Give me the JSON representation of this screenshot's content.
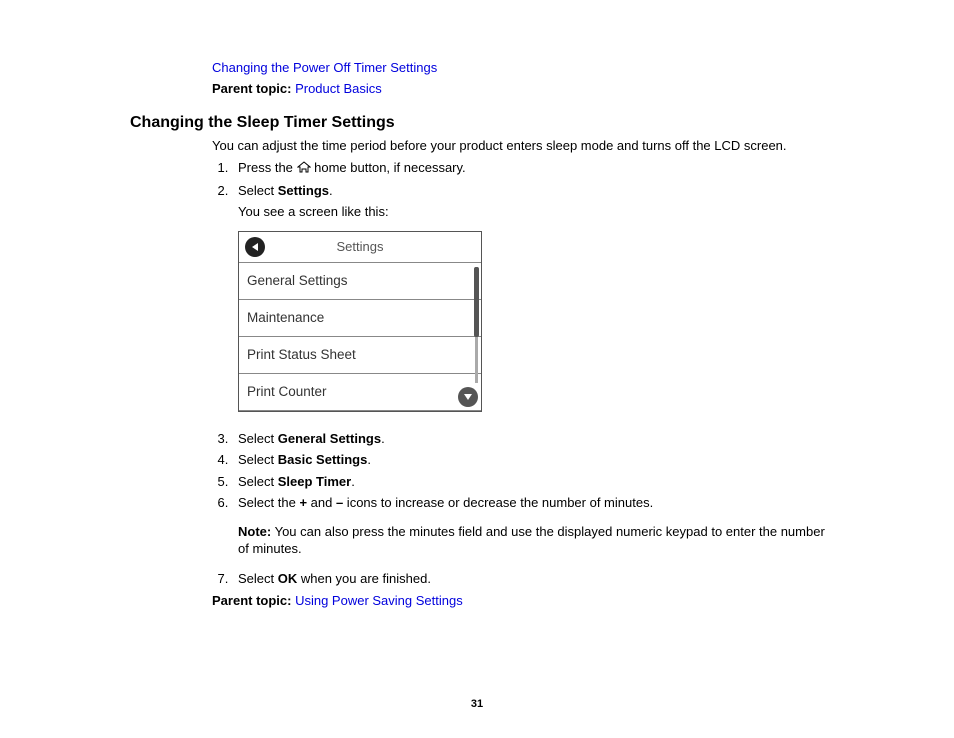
{
  "top_link": "Changing the Power Off Timer Settings",
  "parent_topic_label_1": "Parent topic: ",
  "parent_topic_link_1": "Product Basics",
  "heading": "Changing the Sleep Timer Settings",
  "intro": "You can adjust the time period before your product enters sleep mode and turns off the LCD screen.",
  "step1_a": "Press the ",
  "step1_b": " home button, if necessary.",
  "step2_a": "Select ",
  "step2_bold": "Settings",
  "step2_b": ".",
  "step2_sub": "You see a screen like this:",
  "screen": {
    "title": "Settings",
    "items": [
      "General Settings",
      "Maintenance",
      "Print Status Sheet",
      "Print Counter"
    ]
  },
  "step3_a": "Select ",
  "step3_bold": "General Settings",
  "step3_b": ".",
  "step4_a": "Select ",
  "step4_bold": "Basic Settings",
  "step4_b": ".",
  "step5_a": "Select ",
  "step5_bold": "Sleep Timer",
  "step5_b": ".",
  "step6_a": "Select the ",
  "step6_plus": "+",
  "step6_mid": " and ",
  "step6_minus": "–",
  "step6_b": " icons to increase or decrease the number of minutes.",
  "note_label": "Note:",
  "note_text": " You can also press the minutes field and use the displayed numeric keypad to enter the number of minutes.",
  "step7_a": "Select ",
  "step7_bold": "OK",
  "step7_b": " when you are finished.",
  "parent_topic_label_2": "Parent topic: ",
  "parent_topic_link_2": "Using Power Saving Settings",
  "page_number": "31"
}
